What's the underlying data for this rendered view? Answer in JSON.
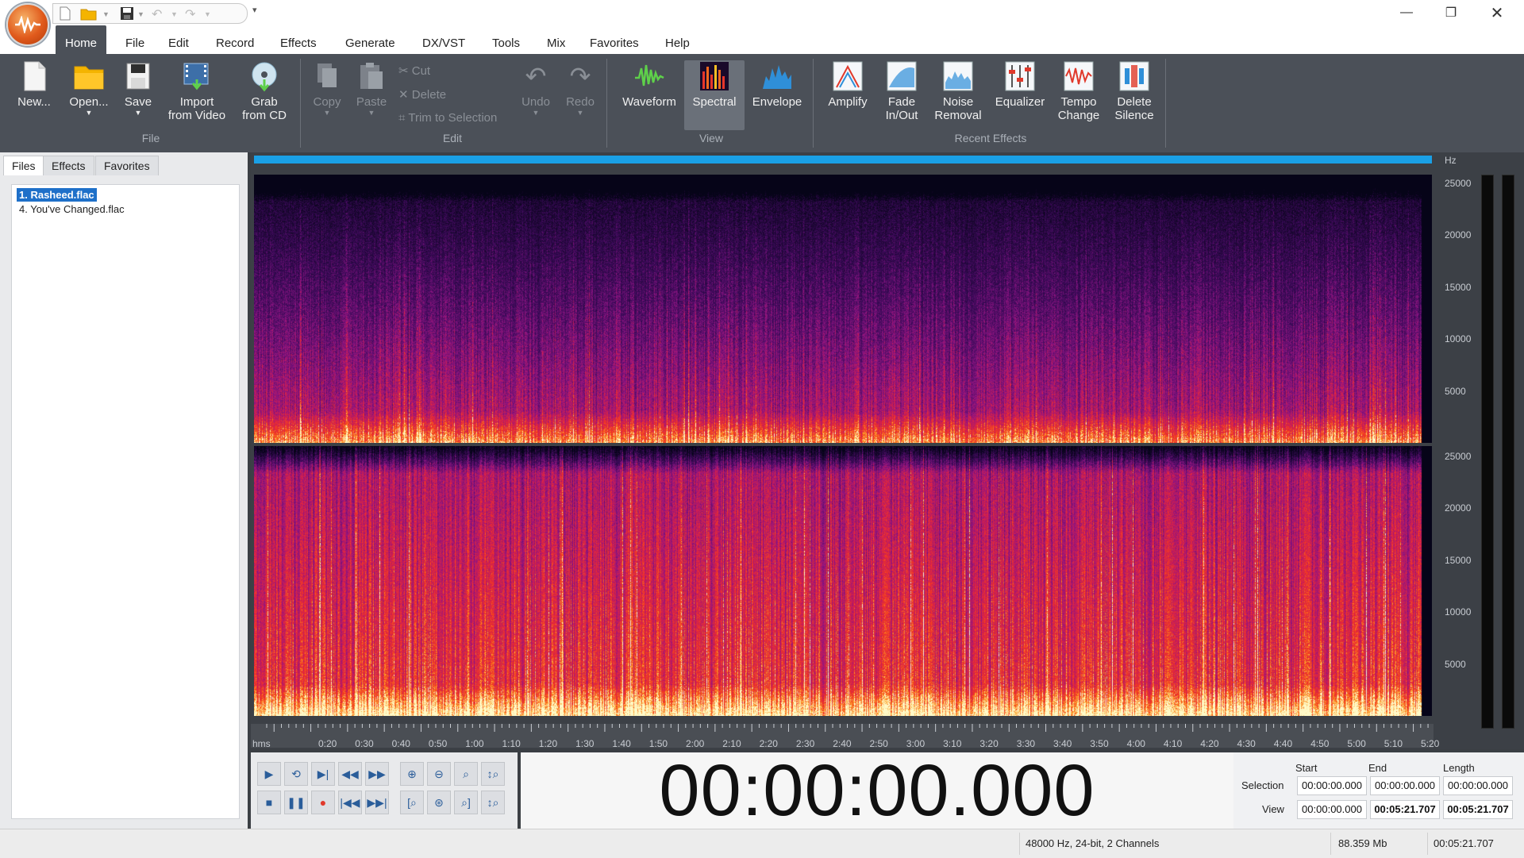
{
  "menu": {
    "items": [
      "Home",
      "File",
      "Edit",
      "Record",
      "Effects",
      "Generate",
      "DX/VST",
      "Tools",
      "Mix",
      "Favorites",
      "Help"
    ],
    "active": "Home"
  },
  "ribbon": {
    "file_group": {
      "label": "File",
      "new": "New...",
      "open": "Open...",
      "save": "Save",
      "import_video_1": "Import",
      "import_video_2": "from Video",
      "grab_cd_1": "Grab",
      "grab_cd_2": "from CD"
    },
    "edit_group": {
      "label": "Edit",
      "copy": "Copy",
      "paste": "Paste",
      "cut": "Cut",
      "delete": "Delete",
      "trim": "Trim to Selection",
      "undo": "Undo",
      "redo": "Redo"
    },
    "view_group": {
      "label": "View",
      "waveform": "Waveform",
      "spectral": "Spectral",
      "envelope": "Envelope"
    },
    "effects_group": {
      "label": "Recent Effects",
      "amplify": "Amplify",
      "fade_1": "Fade",
      "fade_2": "In/Out",
      "noise_1": "Noise",
      "noise_2": "Removal",
      "equalizer": "Equalizer",
      "tempo_1": "Tempo",
      "tempo_2": "Change",
      "silence_1": "Delete",
      "silence_2": "Silence"
    }
  },
  "sidepanel": {
    "tabs": [
      "Files",
      "Effects",
      "Favorites"
    ],
    "files": [
      "1. Rasheed.flac",
      "4. You've Changed.flac"
    ]
  },
  "spectrogram": {
    "unit": "Hz",
    "freq_labels": [
      "25000",
      "20000",
      "15000",
      "10000",
      "5000"
    ]
  },
  "timeline": {
    "unit": "hms",
    "ticks": [
      "0:20",
      "0:30",
      "0:40",
      "0:50",
      "1:00",
      "1:10",
      "1:20",
      "1:30",
      "1:40",
      "1:50",
      "2:00",
      "2:10",
      "2:20",
      "2:30",
      "2:40",
      "2:50",
      "3:00",
      "3:10",
      "3:20",
      "3:30",
      "3:40",
      "3:50",
      "4:00",
      "4:10",
      "4:20",
      "4:30",
      "4:40",
      "4:50",
      "5:00",
      "5:10",
      "5:20"
    ]
  },
  "clock": "00:00:00.000",
  "selection_info": {
    "col_start": "Start",
    "col_end": "End",
    "col_length": "Length",
    "row_selection": "Selection",
    "row_view": "View",
    "selection_start": "00:00:00.000",
    "selection_end": "00:00:00.000",
    "selection_length": "00:00:00.000",
    "view_start": "00:00:00.000",
    "view_end": "00:05:21.707",
    "view_length": "00:05:21.707"
  },
  "status": {
    "format": "48000 Hz, 24-bit, 2 Channels",
    "size": "88.359 Mb",
    "duration": "00:05:21.707"
  },
  "colors": {
    "ribbon_bg": "#4b5058",
    "accent_blue": "#1aa0e6",
    "selection_blue": "#1e70c9"
  }
}
